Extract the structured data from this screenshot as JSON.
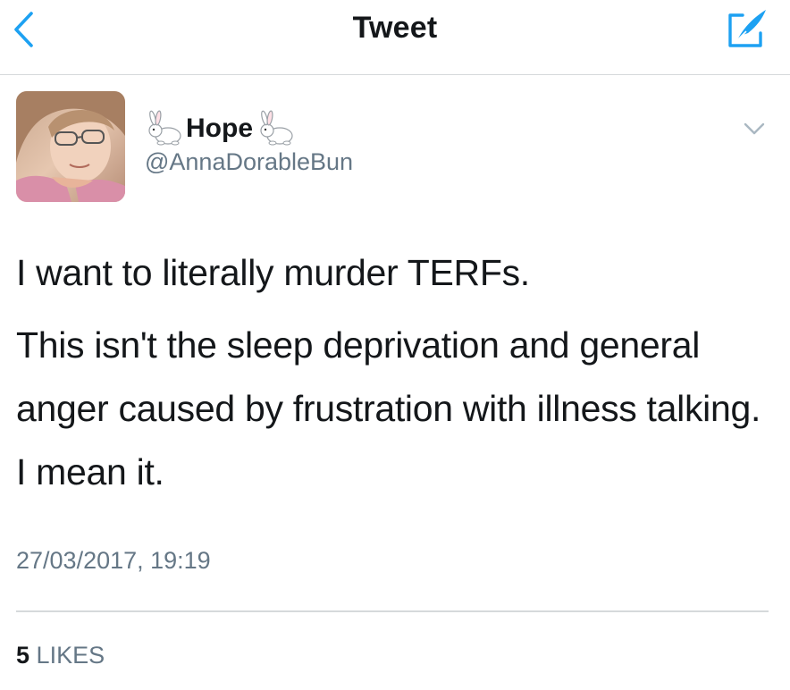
{
  "nav": {
    "title": "Tweet",
    "back_icon": "chevron-left-icon",
    "compose_icon": "compose-feather-icon",
    "accent_color": "#1da1f2"
  },
  "tweet": {
    "author": {
      "display_name": "Hope",
      "name_decoration_icon": "rabbit-emoji",
      "handle": "@AnnaDorableBun"
    },
    "paragraphs": [
      "I want to literally murder TERFs.",
      "This isn't the sleep deprivation and general anger caused by frustration with illness talking. I mean it."
    ],
    "timestamp": "27/03/2017, 19:19",
    "likes": {
      "count": "5",
      "label": "LIKES"
    }
  }
}
